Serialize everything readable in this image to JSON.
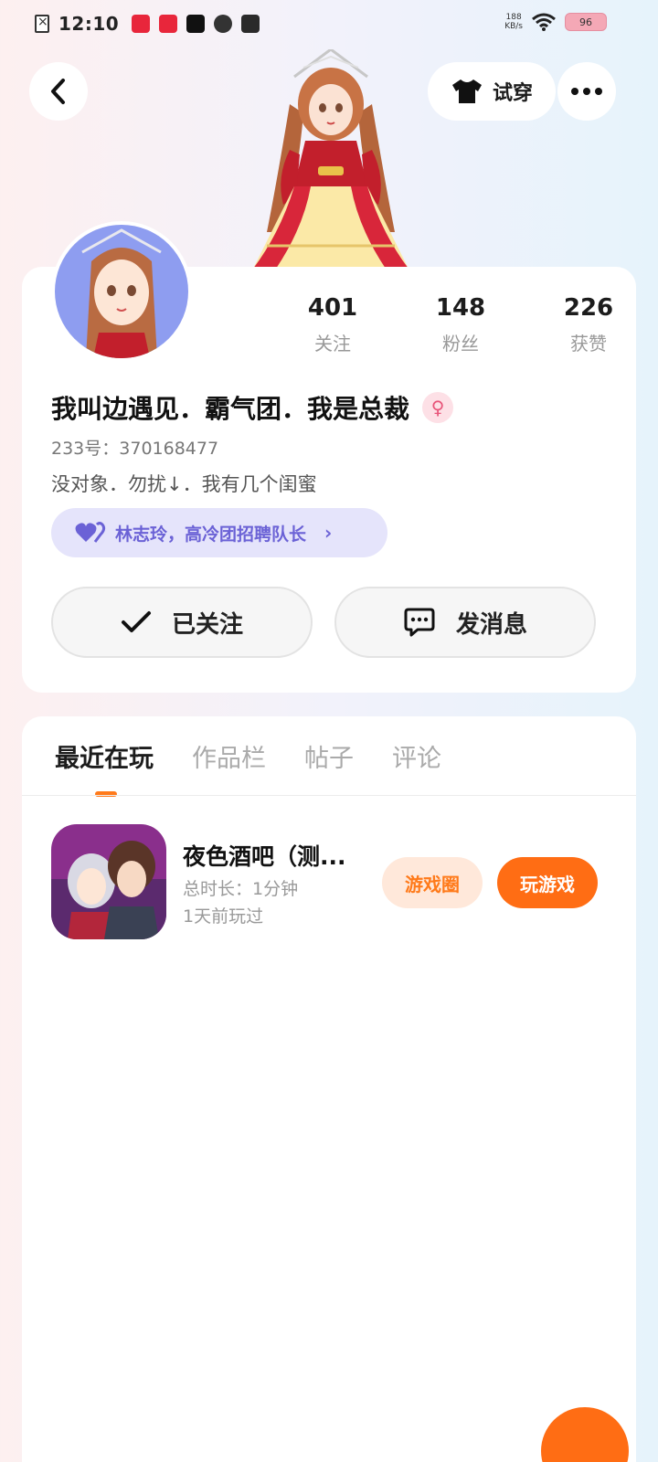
{
  "status_bar": {
    "time": "12:10",
    "net_speed_value": "188",
    "net_speed_unit": "KB/s",
    "battery": "96"
  },
  "header": {
    "tryon_label": "试穿"
  },
  "profile": {
    "stats": [
      {
        "value": "401",
        "label": "关注"
      },
      {
        "value": "148",
        "label": "粉丝"
      },
      {
        "value": "226",
        "label": "获赞"
      }
    ],
    "nickname": "我叫边遇见．霸气团．我是总裁",
    "gender_symbol": "♀",
    "uid": "233号：370168477",
    "bio": "没对象．勿扰↓．我有几个闺蜜",
    "honor": "林志玲，高冷团招聘队长",
    "follow_label": "已关注",
    "message_label": "发消息"
  },
  "tabs": [
    {
      "label": "最近在玩"
    },
    {
      "label": "作品栏"
    },
    {
      "label": "帖子"
    },
    {
      "label": "评论"
    }
  ],
  "games": [
    {
      "name": "夜色酒吧（测...",
      "play_time": "总时长：1分钟",
      "last_played": "1天前玩过",
      "circle_label": "游戏圈",
      "play_label": "玩游戏"
    }
  ],
  "colors": {
    "accent_orange": "#ff6d14",
    "honor_purple": "#6b62d6",
    "honor_bg": "#e5e4fb"
  }
}
